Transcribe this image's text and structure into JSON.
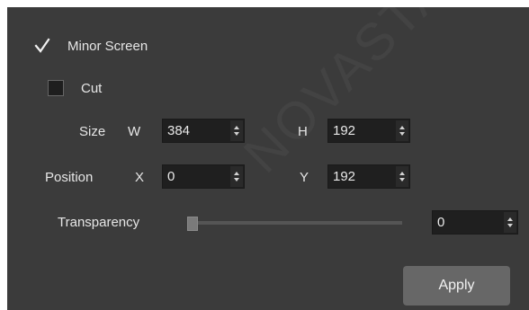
{
  "minor_screen": {
    "label": "Minor Screen",
    "checked": true
  },
  "cut": {
    "label": "Cut",
    "checked": false
  },
  "size": {
    "label": "Size",
    "w_label": "W",
    "w_value": "384",
    "h_label": "H",
    "h_value": "192"
  },
  "position": {
    "label": "Position",
    "x_label": "X",
    "x_value": "0",
    "y_label": "Y",
    "y_value": "192"
  },
  "transparency": {
    "label": "Transparency",
    "value": "0",
    "slider_level": 0
  },
  "apply_button": {
    "label": "Apply"
  },
  "watermark": {
    "text": "NOVASTAR"
  },
  "colors": {
    "panel_bg": "#3b3b3b",
    "field_bg": "#1f1f1f",
    "button_bg": "#676767",
    "text": "#e6e6e6"
  }
}
